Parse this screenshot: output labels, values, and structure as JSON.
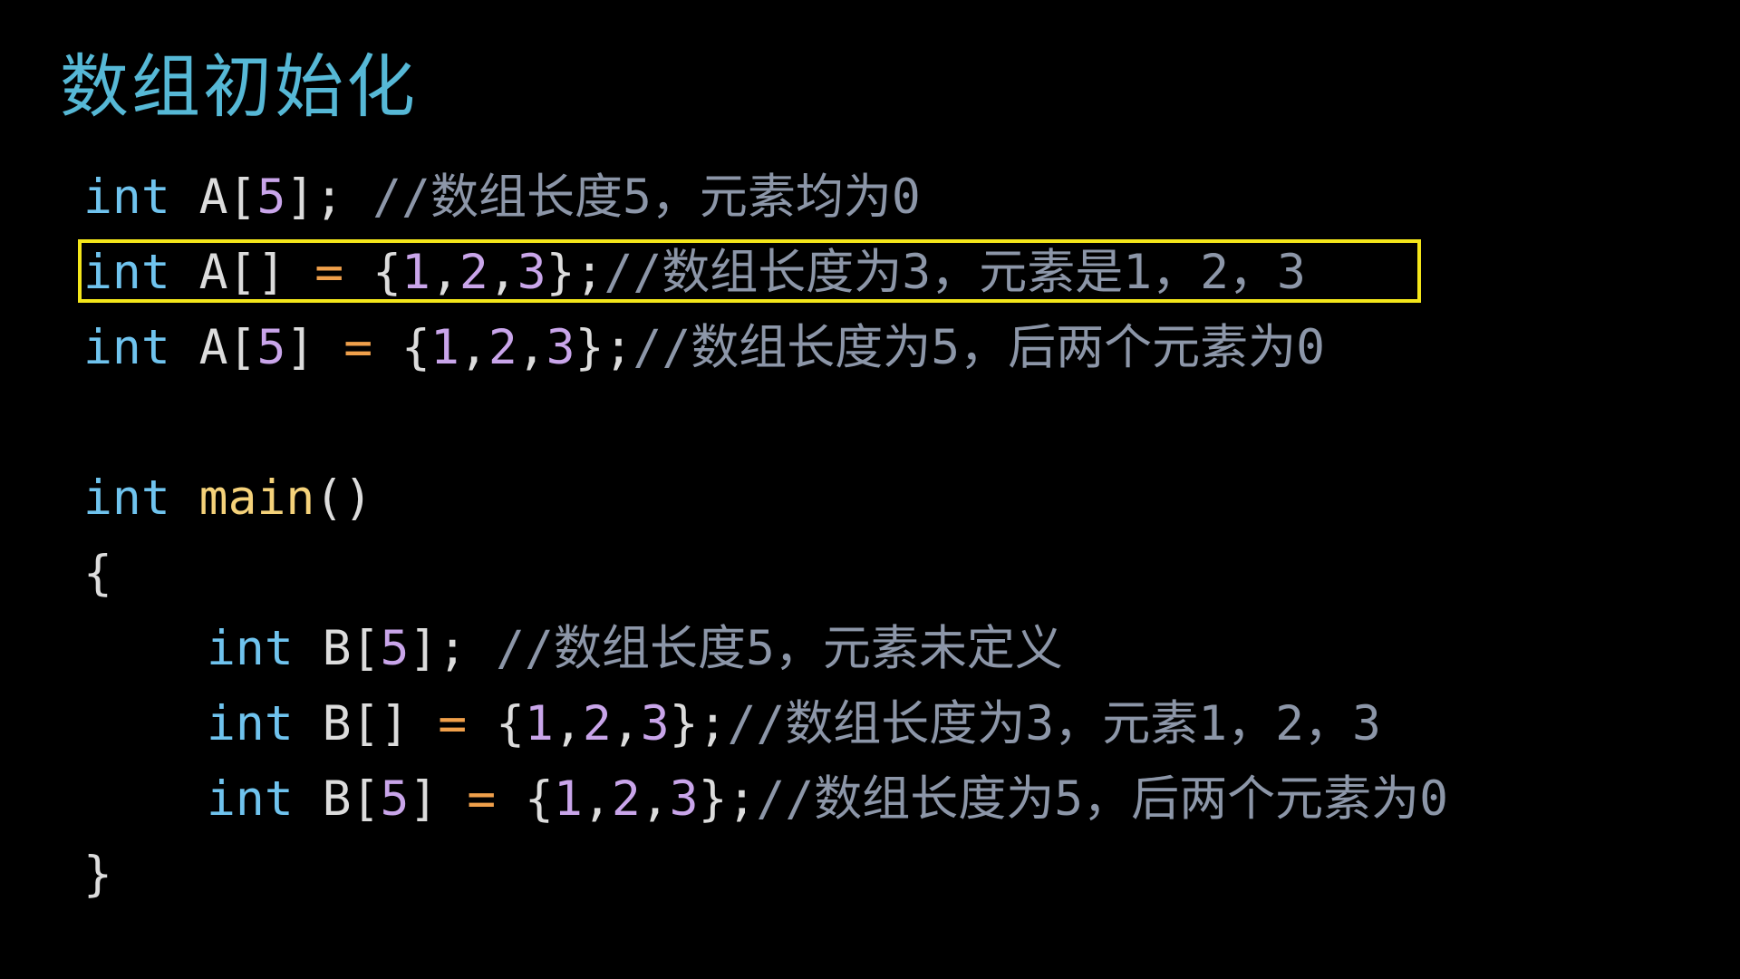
{
  "slide": {
    "title": "数组初始化",
    "colors": {
      "background": "#000000",
      "title": "#56b8d6",
      "keyword": "#6fc3ee",
      "function": "#f5d27a",
      "operator": "#f0a04b",
      "number": "#c9a5ea",
      "text": "#dcdcdc",
      "comment": "#8c96a8",
      "highlight_border": "#f4e61a"
    }
  },
  "code": {
    "line1": {
      "kw": "int",
      "decl": " A[",
      "size": "5",
      "end": "]; ",
      "comment": "//数组长度5，元素均为0"
    },
    "line2": {
      "kw": "int",
      "decl": " A[] ",
      "op": "=",
      "open": " {",
      "n1": "1",
      "n2": "2",
      "n3": "3",
      "close": "};",
      "comment": "//数组长度为3，元素是1，2，3"
    },
    "line3": {
      "kw": "int",
      "decl": " A[",
      "size": "5",
      "end": "] ",
      "op": "=",
      "open": " {",
      "n1": "1",
      "n2": "2",
      "n3": "3",
      "close": "};",
      "comment": "//数组长度为5，后两个元素为0"
    },
    "main_kw": "int",
    "main_name": "main",
    "main_parens": "()",
    "brace_open": "{",
    "brace_close": "}",
    "line4": {
      "kw": "int",
      "decl": " B[",
      "size": "5",
      "end": "]; ",
      "comment": "//数组长度5，元素未定义"
    },
    "line5": {
      "kw": "int",
      "decl": " B[] ",
      "op": "=",
      "open": " {",
      "n1": "1",
      "n2": "2",
      "n3": "3",
      "close": "};",
      "comment": "//数组长度为3，元素1，2，3"
    },
    "line6": {
      "kw": "int",
      "decl": " B[",
      "size": "5",
      "end": "] ",
      "op": "=",
      "open": " {",
      "n1": "1",
      "n2": "2",
      "n3": "3",
      "close": "};",
      "comment": "//数组长度为5，后两个元素为0"
    },
    "comma": ","
  }
}
